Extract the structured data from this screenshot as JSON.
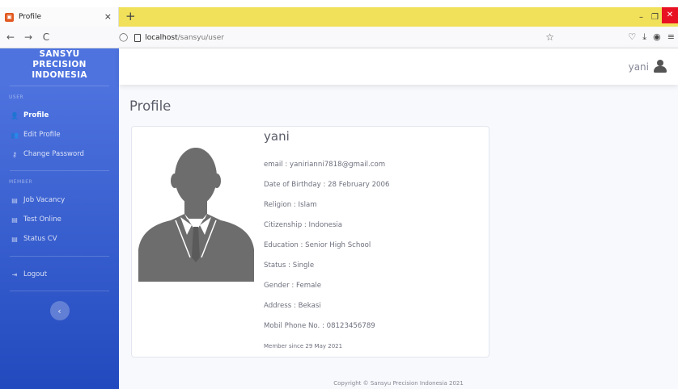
{
  "browser": {
    "tab_title": "Profile",
    "tab_close": "×",
    "new_tab": "+",
    "url_host": "localhost",
    "url_path": "/sansyu/user",
    "nav": {
      "back": "←",
      "forward": "→",
      "reload": "C"
    },
    "window": {
      "minimize": "–",
      "restore": "❐",
      "close": "✕"
    },
    "icons": [
      "shield-icon",
      "page-icon",
      "star-icon",
      "pocket-icon",
      "download-icon",
      "account-icon",
      "menu-icon"
    ]
  },
  "sidebar": {
    "brand": [
      "SANSYU",
      "PRECISION",
      "INDONESIA"
    ],
    "user_heading": "USER",
    "user_items": [
      {
        "label": "Profile",
        "icon": "user-icon",
        "active": true
      },
      {
        "label": "Edit Profile",
        "icon": "user-edit-icon",
        "active": false
      },
      {
        "label": "Change Password",
        "icon": "key-icon",
        "active": false
      }
    ],
    "member_heading": "MEMBER",
    "member_items": [
      {
        "label": "Job Vacancy",
        "icon": "file-icon"
      },
      {
        "label": "Test Online",
        "icon": "file-icon"
      },
      {
        "label": "Status CV",
        "icon": "file-icon"
      }
    ],
    "logout": "Logout",
    "toggle": "‹"
  },
  "topbar": {
    "username": "yani",
    "avatar_icon": "user-avatar-icon"
  },
  "page": {
    "title": "Profile"
  },
  "profile": {
    "name": "yani",
    "email": "email : yanirianni7818@gmail.com",
    "dob": "Date of Birthday : 28 February 2006",
    "religion": "Religion : Islam",
    "citizenship": "Citizenship : Indonesia",
    "education": "Education : Senior High School",
    "status": "Status : Single",
    "gender": "Gender : Female",
    "address": "Address : Bekasi",
    "phone": "Mobil Phone No. : 08123456789",
    "member_since": "Member since 29 May 2021"
  },
  "footer": {
    "copyright": "Copyright © Sansyu Precision Indonesia 2021"
  },
  "colors": {
    "sidebar_top": "#4e73df",
    "sidebar_bottom": "#224abe",
    "tabbar": "#f0e05a",
    "background": "#f8f9fc"
  }
}
